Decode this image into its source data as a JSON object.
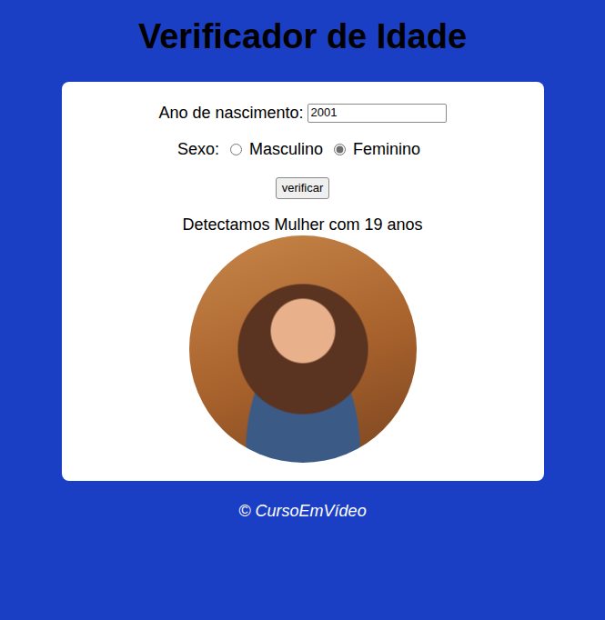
{
  "title": "Verificador de Idade",
  "form": {
    "year": {
      "label": "Ano de nascimento:",
      "value": "2001"
    },
    "sex": {
      "label": "Sexo:",
      "options": [
        {
          "label": "Masculino",
          "selected": false
        },
        {
          "label": "Feminino",
          "selected": true
        }
      ]
    },
    "button": "verificar"
  },
  "result": "Detectamos Mulher com 19 anos",
  "footer": "© CursoEmVídeo"
}
